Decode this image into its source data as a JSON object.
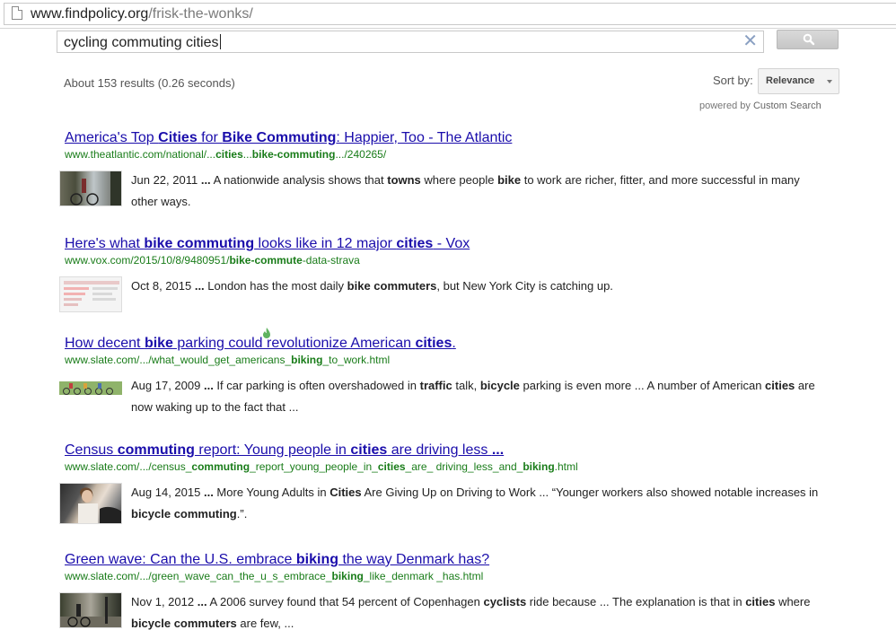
{
  "address_bar": {
    "host": "www.findpolicy.org",
    "path": "/frisk-the-wonks/"
  },
  "search": {
    "query": "cycling commuting cities",
    "button_icon": "search-icon"
  },
  "stats": "About 153 results (0.26 seconds)",
  "sort": {
    "label": "Sort by:",
    "value": "Relevance"
  },
  "powered": {
    "prefix": "powered by",
    "name": "Custom Search"
  },
  "results": [
    {
      "title": [
        {
          "t": "America's Top ",
          "b": false
        },
        {
          "t": "Cities",
          "b": true
        },
        {
          "t": " for ",
          "b": false
        },
        {
          "t": "Bike Commuting",
          "b": true
        },
        {
          "t": ": Happier, Too - The Atlantic",
          "b": false
        }
      ],
      "url": [
        {
          "t": "www.theatlantic.com/national/...",
          "b": false
        },
        {
          "t": "cities",
          "b": true
        },
        {
          "t": "...",
          "b": false
        },
        {
          "t": "bike-commuting",
          "b": true
        },
        {
          "t": ".../240265/",
          "b": false
        }
      ],
      "snippet": [
        {
          "t": "Jun 22, 2011 ",
          "b": false
        },
        {
          "t": "...",
          "b": true
        },
        {
          "t": " A nationwide analysis shows that ",
          "b": false
        },
        {
          "t": "towns",
          "b": true
        },
        {
          "t": " where people ",
          "b": false
        },
        {
          "t": "bike",
          "b": true
        },
        {
          "t": " to work are richer, fitter, and more successful in many other ways.",
          "b": false
        }
      ]
    },
    {
      "title": [
        {
          "t": "Here's what ",
          "b": false
        },
        {
          "t": "bike commuting",
          "b": true
        },
        {
          "t": " looks like in 12 major ",
          "b": false
        },
        {
          "t": "cities",
          "b": true
        },
        {
          "t": " - Vox",
          "b": false
        }
      ],
      "url": [
        {
          "t": "www.vox.com/2015/10/8/9480951/",
          "b": false
        },
        {
          "t": "bike-commute",
          "b": true
        },
        {
          "t": "-data-strava",
          "b": false
        }
      ],
      "snippet": [
        {
          "t": "Oct 8, 2015 ",
          "b": false
        },
        {
          "t": "...",
          "b": true
        },
        {
          "t": " London has the most daily ",
          "b": false
        },
        {
          "t": "bike commuters",
          "b": true
        },
        {
          "t": ", but New York City is catching up.",
          "b": false
        }
      ]
    },
    {
      "title": [
        {
          "t": "How decent ",
          "b": false
        },
        {
          "t": "bike",
          "b": true
        },
        {
          "t": " parking could revolutionize American ",
          "b": false
        },
        {
          "t": "cities",
          "b": true
        },
        {
          "t": ".",
          "b": false
        }
      ],
      "url": [
        {
          "t": "www.slate.com/.../what_would_get_americans_",
          "b": false
        },
        {
          "t": "biking",
          "b": true
        },
        {
          "t": "_to_work.html",
          "b": false
        }
      ],
      "snippet": [
        {
          "t": "Aug 17, 2009 ",
          "b": false
        },
        {
          "t": "...",
          "b": true
        },
        {
          "t": " If car parking is often overshadowed in ",
          "b": false
        },
        {
          "t": "traffic",
          "b": true
        },
        {
          "t": " talk, ",
          "b": false
        },
        {
          "t": "bicycle",
          "b": true
        },
        {
          "t": " parking is even more ... A number of American ",
          "b": false
        },
        {
          "t": "cities",
          "b": true
        },
        {
          "t": " are now waking up to the fact that ...",
          "b": false
        }
      ]
    },
    {
      "title": [
        {
          "t": "Census ",
          "b": false
        },
        {
          "t": "commuting",
          "b": true
        },
        {
          "t": " report: Young people in ",
          "b": false
        },
        {
          "t": "cities",
          "b": true
        },
        {
          "t": " are driving less ",
          "b": false
        },
        {
          "t": "...",
          "b": true
        }
      ],
      "url": [
        {
          "t": "www.slate.com/.../census_",
          "b": false
        },
        {
          "t": "commuting",
          "b": true
        },
        {
          "t": "_report_young_people_in_",
          "b": false
        },
        {
          "t": "cities",
          "b": true
        },
        {
          "t": "_are_ driving_less_and_",
          "b": false
        },
        {
          "t": "biking",
          "b": true
        },
        {
          "t": ".html",
          "b": false
        }
      ],
      "snippet": [
        {
          "t": "Aug 14, 2015 ",
          "b": false
        },
        {
          "t": "...",
          "b": true
        },
        {
          "t": " More Young Adults in ",
          "b": false
        },
        {
          "t": "Cities",
          "b": true
        },
        {
          "t": " Are Giving Up on Driving to Work ... “Younger workers also showed notable increases in ",
          "b": false
        },
        {
          "t": "bicycle commuting",
          "b": true
        },
        {
          "t": ".”.",
          "b": false
        }
      ]
    },
    {
      "title": [
        {
          "t": "Green wave: Can the U.S. embrace ",
          "b": false
        },
        {
          "t": "biking",
          "b": true
        },
        {
          "t": " the way Denmark has?",
          "b": false
        }
      ],
      "url": [
        {
          "t": "www.slate.com/.../green_wave_can_the_u_s_embrace_",
          "b": false
        },
        {
          "t": "biking",
          "b": true
        },
        {
          "t": "_like_denmark _has.html",
          "b": false
        }
      ],
      "snippet": [
        {
          "t": "Nov 1, 2012 ",
          "b": false
        },
        {
          "t": "...",
          "b": true
        },
        {
          "t": " A 2006 survey found that 54 percent of Copenhagen ",
          "b": false
        },
        {
          "t": "cyclists",
          "b": true
        },
        {
          "t": " ride because ... The explanation is that in ",
          "b": false
        },
        {
          "t": "cities",
          "b": true
        },
        {
          "t": " where ",
          "b": false
        },
        {
          "t": "bicycle commuters",
          "b": true
        },
        {
          "t": " are few, ...",
          "b": false
        }
      ]
    }
  ],
  "colors": {
    "link": "#1a0dab",
    "url": "#197c19",
    "text": "#222222"
  }
}
